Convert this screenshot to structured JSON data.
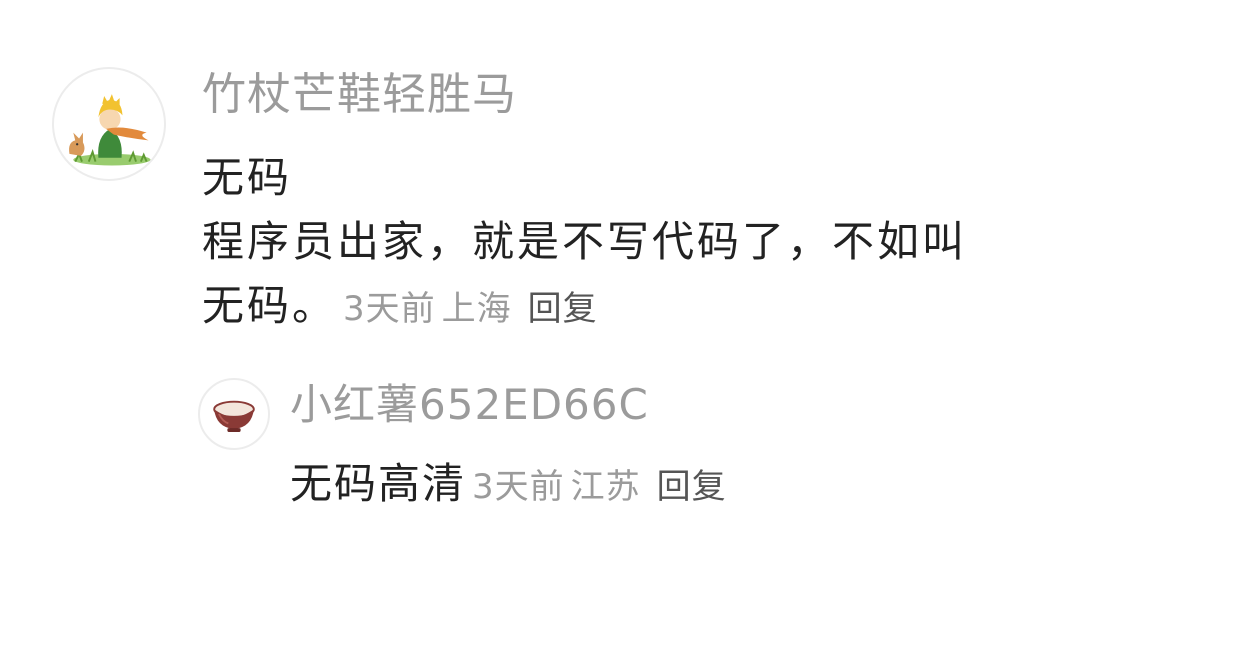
{
  "main_comment": {
    "avatar_icon": "little-prince-icon",
    "username": "竹杖芒鞋轻胜马",
    "content_line1": "无码",
    "content_line2": "程序员出家，就是不写代码了，不如叫",
    "content_line3": "无码。",
    "time": "3天前",
    "location": "上海",
    "reply_label": "回复"
  },
  "reply_comment": {
    "avatar_icon": "bowl-icon",
    "username": "小红薯652ED66C",
    "content": "无码高清",
    "time": "3天前",
    "location": "江苏",
    "reply_label": "回复"
  }
}
